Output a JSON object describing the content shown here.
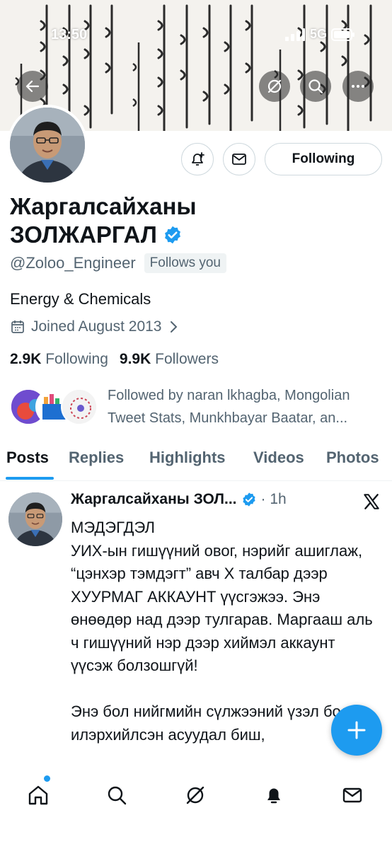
{
  "status_bar": {
    "time": "13:50",
    "network": "5G"
  },
  "profile": {
    "display_name": "Жаргалсайханы ЗОЛЖАРГАЛ",
    "name_line1": "Жаргалсайханы",
    "name_line2": "ЗОЛЖАРГАЛ",
    "verified": true,
    "handle": "@Zoloo_Engineer",
    "follows_you": "Follows you",
    "bio": "Energy & Chemicals",
    "joined": "Joined August 2013",
    "following_count": "2.9K",
    "following_label": "Following",
    "followers_count": "9.9K",
    "followers_label": "Followers",
    "followed_by": "Followed by naran lkhagba, Mongolian Tweet Stats, Munkhbayar Baatar, an..."
  },
  "actions": {
    "following_button": "Following"
  },
  "tabs": [
    {
      "label": "Posts",
      "active": true
    },
    {
      "label": "Replies",
      "active": false
    },
    {
      "label": "Highlights",
      "active": false
    },
    {
      "label": "Videos",
      "active": false
    },
    {
      "label": "Photos",
      "active": false
    }
  ],
  "tweet": {
    "author": "Жаргалсайханы ЗОЛ...",
    "verified": true,
    "time": "· 1h",
    "text": "МЭДЭГДЭЛ\nУИХ-ын гишүүний овог, нэрийг ашиглаж, “цэнхэр тэмдэгт” авч X талбар дээр ХУУРМАГ АККАУНТ үүсгэжээ. Энэ өнөөдөр над дээр тулгарав. Маргааш аль ч гишүүний нэр дээр хиймэл аккаунт үүсэж болзошгүй!\n\nЭнэ бол нийгмийн сүлжээний үзэл бодол илэрхийлсэн асуудал биш,"
  },
  "colors": {
    "accent": "#1d9bf0",
    "text_primary": "#0f1419",
    "text_secondary": "#536471",
    "border": "#cfd9de"
  },
  "icons": [
    "back-arrow-icon",
    "grok-icon",
    "search-icon",
    "more-icon",
    "notification-bell-plus-icon",
    "mail-icon",
    "calendar-icon",
    "chevron-right-icon",
    "verified-badge-icon",
    "x-logo-icon",
    "plus-icon",
    "home-icon",
    "search-nav-icon",
    "grok-nav-icon",
    "bell-icon",
    "messages-icon"
  ]
}
